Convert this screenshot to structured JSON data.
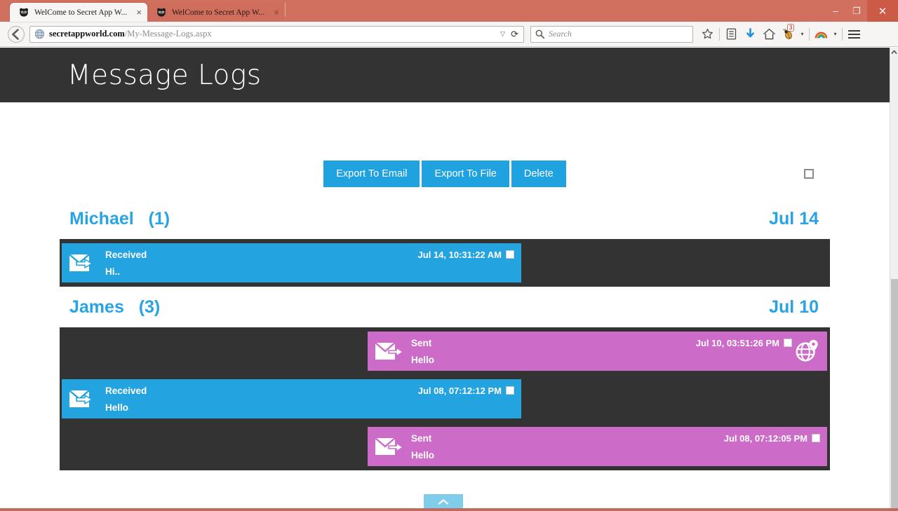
{
  "browser": {
    "tabs": [
      {
        "title": "WelCome to Secret App W...",
        "active": true,
        "favicon": "owl-icon",
        "close": "×"
      },
      {
        "title": "WelCome to Secret App W...",
        "active": false,
        "favicon": "owl-icon",
        "close": "×"
      }
    ],
    "window_controls": {
      "minimize": "–",
      "restore": "❐",
      "close": "✕"
    },
    "url": {
      "domain": "secretappworld.com",
      "path": "/My-Message-Logs.aspx"
    },
    "url_dropdown": "▽",
    "reload": "⟳",
    "search": {
      "placeholder": "Search"
    },
    "toolbar_icons": [
      {
        "name": "bookmark-star-icon",
        "glyph": "☆"
      },
      {
        "name": "reader-list-icon",
        "glyph": "▤"
      },
      {
        "name": "download-arrow-icon",
        "glyph": "↓"
      },
      {
        "name": "home-icon",
        "glyph": "⌂"
      },
      {
        "name": "addon-bug-icon",
        "glyph": "🐞",
        "badge": "3"
      },
      {
        "name": "addon-dropdown-caret",
        "glyph": "▾"
      },
      {
        "name": "rainbow-icon",
        "glyph": "◜"
      },
      {
        "name": "rainbow-dropdown-caret",
        "glyph": "▾"
      },
      {
        "name": "menu-hamburger-icon",
        "glyph": "≡"
      }
    ]
  },
  "page": {
    "title": "Message Logs",
    "toolbar": {
      "export_email": "Export To Email",
      "export_file": "Export To File",
      "delete": "Delete"
    },
    "scroll_top_glyph": "⌃",
    "conversations": [
      {
        "name": "Michael",
        "count": "(1)",
        "date": "Jul 14",
        "messages": [
          {
            "direction": "Received",
            "time": "Jul 14, 10:31:22 AM",
            "text": "Hi..",
            "icon": "envelope-incoming-icon",
            "has_location": false
          }
        ]
      },
      {
        "name": "James",
        "count": "(3)",
        "date": "Jul 10",
        "messages": [
          {
            "direction": "Sent",
            "time": "Jul 10, 03:51:26 PM",
            "text": "Hello",
            "icon": "envelope-outgoing-icon",
            "has_location": true
          },
          {
            "direction": "Received",
            "time": "Jul 08, 07:12:12 PM",
            "text": "Hello",
            "icon": "envelope-incoming-icon",
            "has_location": false
          },
          {
            "direction": "Sent",
            "time": "Jul 08, 07:12:05 PM",
            "text": "Hello",
            "icon": "envelope-outgoing-icon",
            "has_location": false
          }
        ]
      }
    ]
  },
  "colors": {
    "header_bg": "#333333",
    "accent_blue": "#2aa3e4",
    "button_blue": "#1fa2e0",
    "received_bubble": "#23a3e0",
    "sent_bubble": "#cc6cc8",
    "chrome_red": "#d2705f"
  }
}
